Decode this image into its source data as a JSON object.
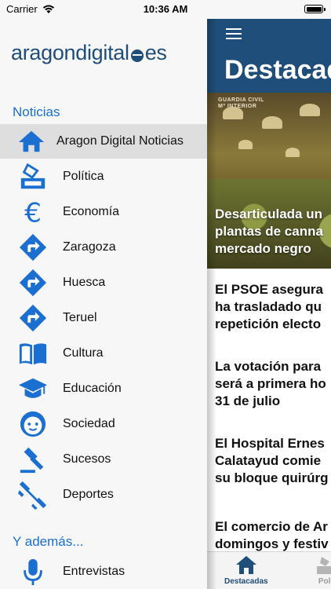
{
  "status_bar": {
    "carrier": "Carrier",
    "time": "10:36 AM"
  },
  "drawer": {
    "logo": {
      "name": "aragondigital",
      "tld": "es"
    },
    "sections": [
      {
        "title": "Noticias",
        "items": [
          {
            "label": "Aragon Digital Noticias",
            "icon": "home-icon",
            "active": true
          },
          {
            "label": "Política",
            "icon": "ballot-box-icon"
          },
          {
            "label": "Economía",
            "icon": "euro-icon"
          },
          {
            "label": "Zaragoza",
            "icon": "direction-sign-icon"
          },
          {
            "label": "Huesca",
            "icon": "direction-sign-icon"
          },
          {
            "label": "Teruel",
            "icon": "direction-sign-icon"
          },
          {
            "label": "Cultura",
            "icon": "book-icon"
          },
          {
            "label": "Educación",
            "icon": "graduation-cap-icon"
          },
          {
            "label": "Sociedad",
            "icon": "face-icon"
          },
          {
            "label": "Sucesos",
            "icon": "gavel-icon"
          },
          {
            "label": "Deportes",
            "icon": "dumbbell-icon"
          }
        ]
      },
      {
        "title": "Y además...",
        "items": [
          {
            "label": "Entrevistas",
            "icon": "microphone-icon"
          }
        ]
      }
    ]
  },
  "main": {
    "title": "Destacad",
    "hero": {
      "stamp_line1": "GUARDIA CIVIL",
      "stamp_line2": "Mº INTERIOR",
      "headline_lines": [
        "Desarticulada un",
        "plantas de canna",
        "mercado negro"
      ]
    },
    "articles": [
      {
        "lines": [
          "El PSOE asegura",
          "ha trasladado qu",
          "repetición electo"
        ]
      },
      {
        "lines": [
          "La votación para",
          "será a primera ho",
          "31 de julio"
        ]
      },
      {
        "lines": [
          "El Hospital Ernes",
          "Calatayud comie",
          "su bloque quirúrg"
        ]
      },
      {
        "lines": [
          "El comercio de Ar",
          "domingos y festiv"
        ]
      }
    ],
    "tabs": [
      {
        "label": "Destacadas",
        "icon": "home-icon",
        "active": true
      },
      {
        "label": "Polí",
        "icon": "ballot-box-icon",
        "active": false
      }
    ]
  },
  "colors": {
    "accent_blue": "#1a6fd1",
    "header_navy": "#1e4e79",
    "logo_navy": "#1f4e78"
  }
}
